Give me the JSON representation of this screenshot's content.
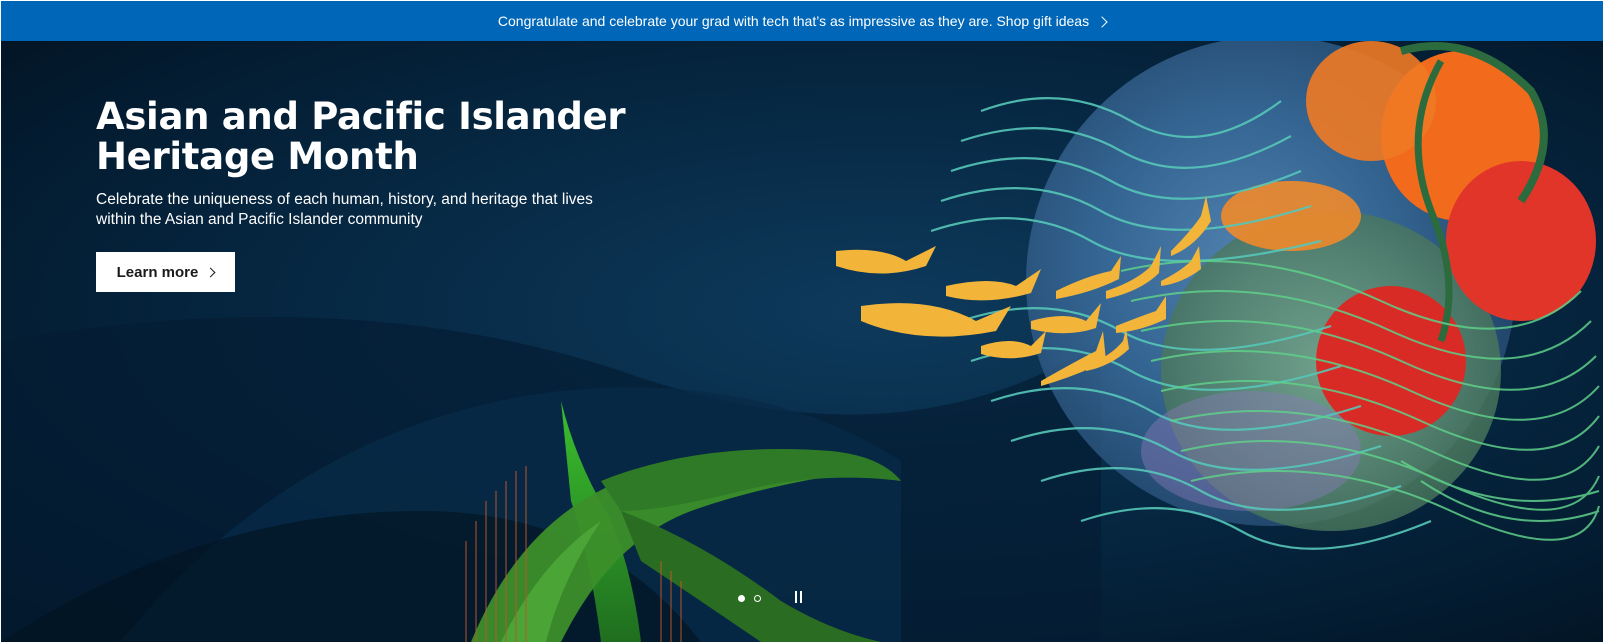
{
  "promo_banner": {
    "text": "Congratulate and celebrate your grad with tech that’s as impressive as they are. Shop gift ideas",
    "icon": "chevron-right-icon",
    "color": "#0067b8"
  },
  "hero": {
    "title": "Asian and Pacific Islander Heritage Month",
    "description": "Celebrate the uniqueness of each human, history, and heritage that lives within the Asian and Pacific Islander community",
    "cta_label": "Learn more",
    "cta_icon": "chevron-right-icon"
  },
  "carousel": {
    "slide_count": 2,
    "active_slide": 1,
    "pause_icon": "pause-icon"
  }
}
